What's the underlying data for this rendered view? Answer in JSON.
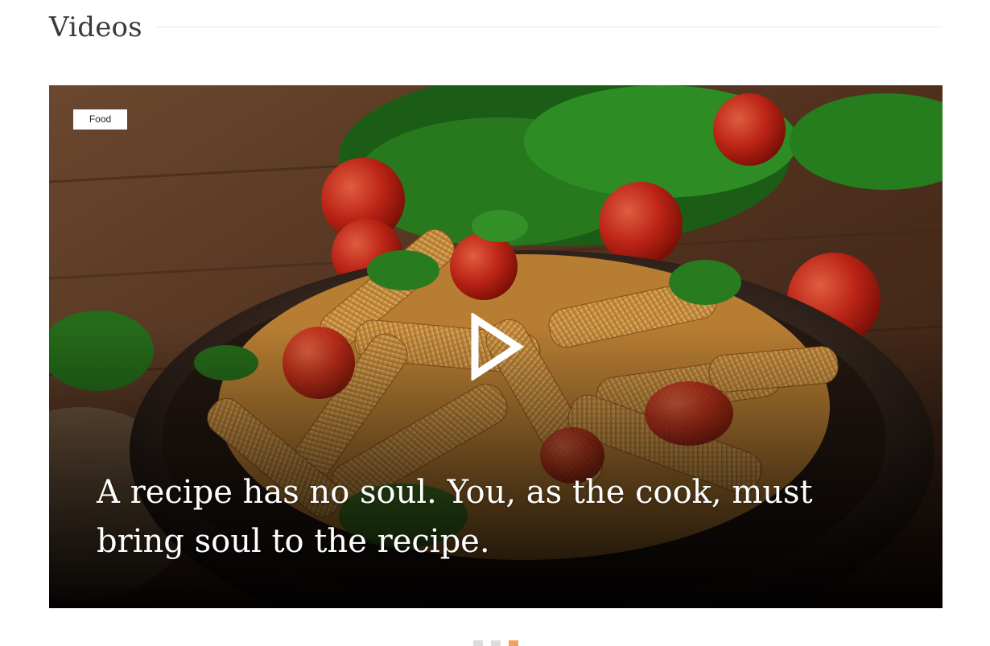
{
  "section": {
    "title": "Videos"
  },
  "video": {
    "category": "Food",
    "caption": "A recipe has no soul. You, as the cook, must bring soul to the recipe.",
    "play_icon": "play-icon"
  },
  "pager": {
    "count": 3,
    "active_index": 2,
    "active_color": "#f0a35c",
    "inactive_color": "#dcdcdc"
  }
}
